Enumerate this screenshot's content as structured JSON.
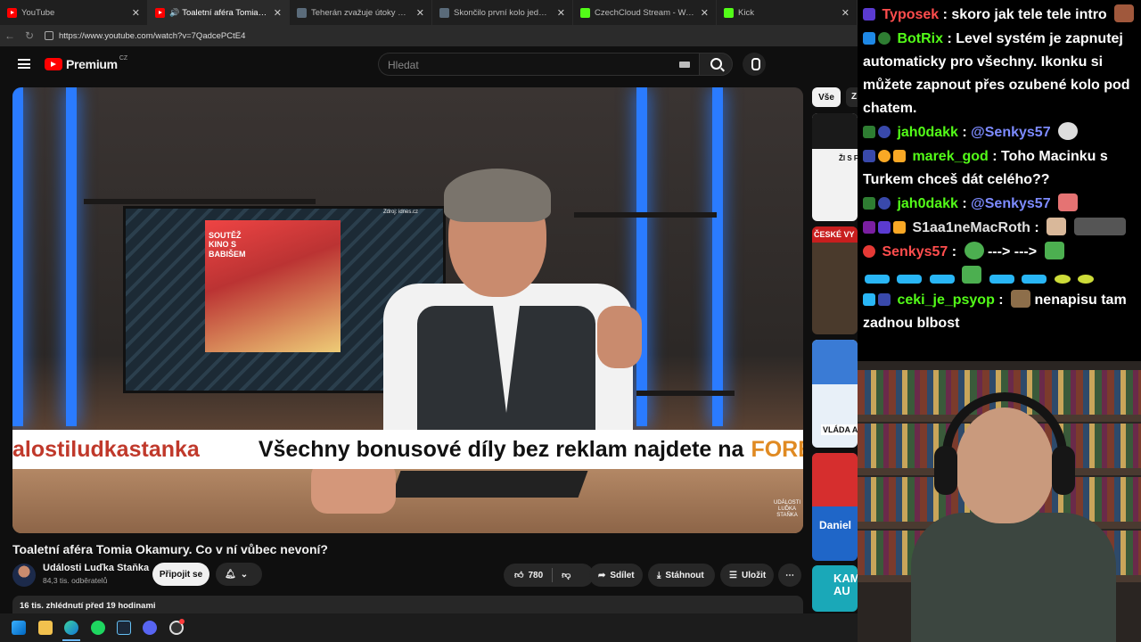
{
  "browser": {
    "tabs": [
      {
        "title": "YouTube",
        "fav": "yt",
        "active": false
      },
      {
        "title": "Toaletní aféra Tomia Okamury",
        "fav": "yt",
        "active": true,
        "audio": true
      },
      {
        "title": "Teherán zvažuje útoky na vojensk",
        "fav": "gray",
        "active": false
      },
      {
        "title": "Skončilo první kolo jednání minist",
        "fav": "gray",
        "active": false
      },
      {
        "title": "CzechCloud Stream - Watch Live o",
        "fav": "kick",
        "active": false
      },
      {
        "title": "Kick",
        "fav": "kick",
        "active": false
      }
    ],
    "url": "https://www.youtube.com/watch?v=7QadcePCtE4"
  },
  "youtube": {
    "logo_text": "Premium",
    "logo_country": "CZ",
    "search_placeholder": "Hledat",
    "video": {
      "banner_left": "alostiludkastanka",
      "banner_main": "Všechny bonusové díly bez reklam najdete na",
      "banner_site": "FORENDORS.CZ",
      "tv_sign": "Zdroj: idnes.cz",
      "poster_text": "SOUTĚŽ KINO S BABIŠEM",
      "corner_logo": "UDÁLOSTI LUĎKA STAŇKA"
    },
    "title": "Toaletní aféra Tomia Okamury. Co v ní vůbec nevoní?",
    "channel": {
      "name": "Události Luďka Staňka",
      "subscribers": "84,3 tis. odběratelů",
      "join_label": "Připojit se"
    },
    "actions": {
      "likes": "780",
      "share": "Sdílet",
      "download": "Stáhnout",
      "save": "Uložit"
    },
    "description": "16 tis. zhlédnutí  před 19 hodinami",
    "chips": [
      "Vše",
      "Z"
    ],
    "recommendations": [
      {
        "text": "ŽI S FO",
        "bg": "#f2f2f2",
        "fg": "#111"
      },
      {
        "text": "ČESKÉ VY",
        "bg": "#5a4a3a",
        "fg": "#fff"
      },
      {
        "text": "VLÁDA A",
        "bg": "#e8f0f8",
        "fg": "#111"
      },
      {
        "text": "Daniel",
        "bg": "#1f66c8",
        "fg": "#fff"
      },
      {
        "text": "KAM AU",
        "bg": "#1aa8b8",
        "fg": "#fff"
      }
    ]
  },
  "chat": [
    {
      "user": "Typosek",
      "color": "#ff4d4d",
      "text": "skoro jak tele tele intro"
    },
    {
      "user": "BotRix",
      "color": "#53fc18",
      "text": "Level systém je zapnutej automaticky pro všechny. Ikonku si můžete zapnout přes ozubené kolo pod chatem."
    },
    {
      "user": "jah0dakk",
      "color": "#53fc18",
      "text": "@Senkys57",
      "mention": true
    },
    {
      "user": "marek_god",
      "color": "#53fc18",
      "text": "Toho Macinku s Turkem chceš dát celého??"
    },
    {
      "user": "jah0dakk",
      "color": "#53fc18",
      "text": "@Senkys57",
      "mention": true
    },
    {
      "user": "S1aa1neMacRoth",
      "color": "#e0e0e0",
      "text": ""
    },
    {
      "user": "Senkys57",
      "color": "#ff4d4d",
      "text": "---> --->"
    },
    {
      "user": "ceki_je_psyop",
      "color": "#53fc18",
      "text": "nenapisu tam zadnou blbost"
    }
  ],
  "colors": {
    "accent_red": "#ff0000",
    "kick_green": "#53fc18",
    "mention_blue": "#7d8bff"
  }
}
